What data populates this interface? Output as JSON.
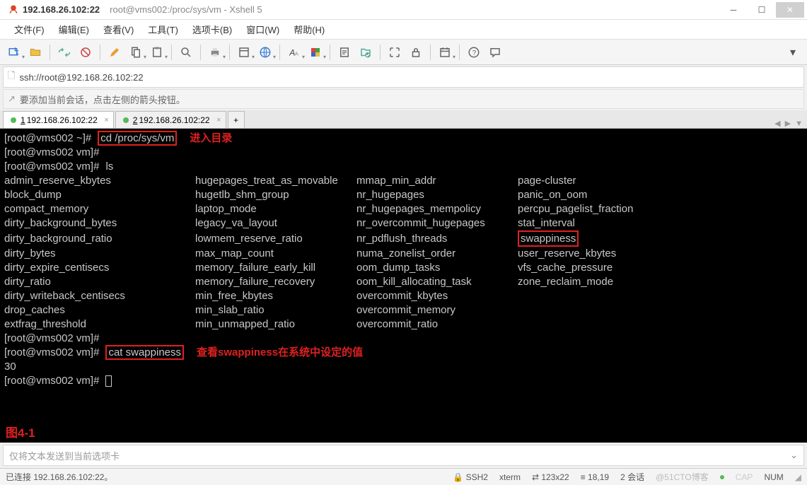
{
  "titlebar": {
    "host": "192.168.26.102:22",
    "path": "root@vms002:/proc/sys/vm - Xshell 5"
  },
  "menu": [
    "文件(F)",
    "编辑(E)",
    "查看(V)",
    "工具(T)",
    "选项卡(B)",
    "窗口(W)",
    "帮助(H)"
  ],
  "addressbar": {
    "url": "ssh://root@192.168.26.102:22"
  },
  "hint": "要添加当前会话，点击左侧的箭头按钮。",
  "tabs": [
    {
      "num": "1",
      "label": "192.168.26.102:22",
      "active": true
    },
    {
      "num": "2",
      "label": "192.168.26.102:22",
      "active": false
    }
  ],
  "terminal": {
    "prompt_home": "[root@vms002 ~]#",
    "prompt_vm": "[root@vms002 vm]#",
    "cmd_cd": "cd /proc/sys/vm",
    "anno_cd": "进入目录",
    "cmd_ls": "ls",
    "cmd_cat": "cat swappiness",
    "anno_cat": "查看swappiness在系统中设定的值",
    "cat_output": "30",
    "hl_file": "swappiness",
    "fig_label": "图4-1",
    "listing": {
      "col1": [
        "admin_reserve_kbytes",
        "block_dump",
        "compact_memory",
        "dirty_background_bytes",
        "dirty_background_ratio",
        "dirty_bytes",
        "dirty_expire_centisecs",
        "dirty_ratio",
        "dirty_writeback_centisecs",
        "drop_caches",
        "extfrag_threshold"
      ],
      "col2": [
        "hugepages_treat_as_movable",
        "hugetlb_shm_group",
        "laptop_mode",
        "legacy_va_layout",
        "lowmem_reserve_ratio",
        "max_map_count",
        "memory_failure_early_kill",
        "memory_failure_recovery",
        "min_free_kbytes",
        "min_slab_ratio",
        "min_unmapped_ratio"
      ],
      "col3": [
        "mmap_min_addr",
        "nr_hugepages",
        "nr_hugepages_mempolicy",
        "nr_overcommit_hugepages",
        "nr_pdflush_threads",
        "numa_zonelist_order",
        "oom_dump_tasks",
        "oom_kill_allocating_task",
        "overcommit_kbytes",
        "overcommit_memory",
        "overcommit_ratio"
      ],
      "col4": [
        "page-cluster",
        "panic_on_oom",
        "percpu_pagelist_fraction",
        "stat_interval",
        "swappiness",
        "user_reserve_kbytes",
        "vfs_cache_pressure",
        "zone_reclaim_mode"
      ]
    }
  },
  "inputbar": {
    "placeholder": "仅将文本发送到当前选项卡"
  },
  "statusbar": {
    "left": "已连接 192.168.26.102:22。",
    "ssh": "SSH2",
    "term": "xterm",
    "size": "123x22",
    "pos": "18,19",
    "sessions": "2 会话",
    "watermark": "@51CTO博客",
    "caps": "CAP",
    "num": "NUM"
  }
}
